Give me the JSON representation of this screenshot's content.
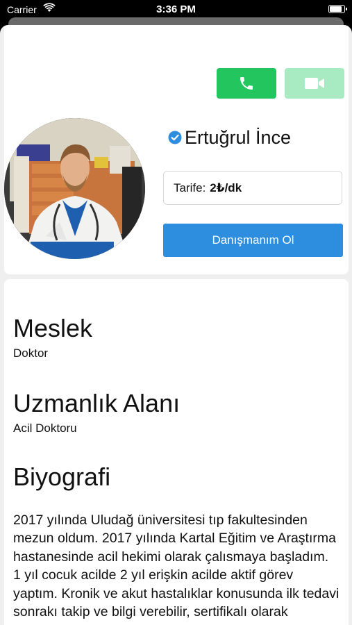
{
  "status_bar": {
    "carrier": "Carrier",
    "time": "3:36 PM"
  },
  "profile": {
    "name": "Ertuğrul İnce",
    "tariff_label": "Tarife:",
    "tariff_value": "2₺/dk",
    "advisor_button": "Danışmanım Ol"
  },
  "sections": [
    {
      "title": "Meslek",
      "value": "Doktor"
    },
    {
      "title": "Uzmanlık Alanı",
      "value": "Acil Doktoru"
    }
  ],
  "bio": {
    "title": "Biyografi",
    "text": "2017 yılında Uludağ üniversitesi tıp fakultesinden mezun oldum. 2017 yılında Kartal Eğitim ve Araştırma hastanesinde acil hekimi olarak çalısmaya başladım. 1 yıl cocuk acilde 2 yıl erişkin acilde aktif görev yaptım. Kronik ve akut hastalıklar konusunda ilk tedavi sonrakı takip ve bilgi verebilir, sertifikalı olarak"
  },
  "icons": {
    "call": "phone-icon",
    "video": "video-camera-icon",
    "verified": "verified-badge-icon"
  },
  "colors": {
    "call_button": "#22c55e",
    "video_button_disabled": "#a8ebc2",
    "primary_button": "#2d8ddf",
    "verified": "#2d8ddf"
  }
}
